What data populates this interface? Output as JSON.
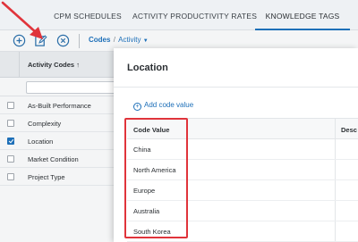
{
  "tabs": [
    {
      "label": "CPM SCHEDULES",
      "active": false
    },
    {
      "label": "ACTIVITY PRODUCTIVITY RATES",
      "active": false
    },
    {
      "label": "KNOWLEDGE TAGS",
      "active": true
    }
  ],
  "toolbar": {
    "icons": [
      "add-circle-icon",
      "edit-icon",
      "delete-circle-icon"
    ],
    "breadcrumb": {
      "root": "Codes",
      "separator": "/",
      "current": "Activity"
    }
  },
  "grid": {
    "header": "Activity Codes",
    "sort_indicator": "↑",
    "rows": [
      {
        "label": "As-Built Performance",
        "checked": false
      },
      {
        "label": "Complexity",
        "checked": false
      },
      {
        "label": "Location",
        "checked": true
      },
      {
        "label": "Market Condition",
        "checked": false
      },
      {
        "label": "Project Type",
        "checked": false
      }
    ]
  },
  "modal": {
    "title": "Location",
    "add_label": "Add code value",
    "columns": [
      "Code Value",
      "Desc"
    ],
    "values": [
      "China",
      "North America",
      "Europe",
      "Australia",
      "South Korea"
    ]
  },
  "colors": {
    "accent": "#1d6fb8",
    "highlight": "#e0343b"
  }
}
